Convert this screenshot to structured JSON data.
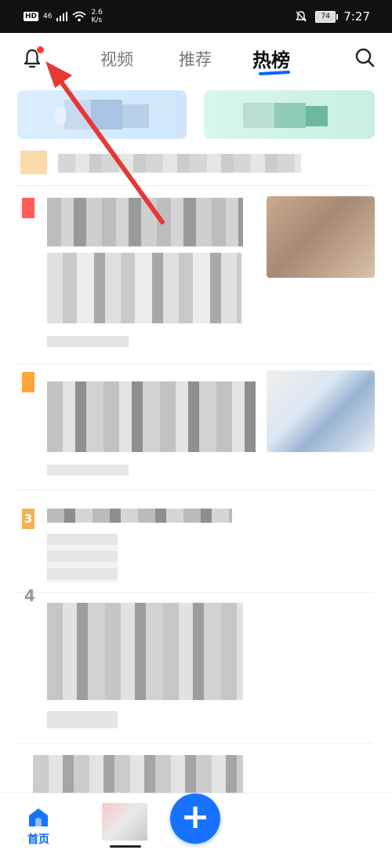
{
  "status_bar": {
    "hd": "HD",
    "signal": "46",
    "net_speed_value": "2.6",
    "net_speed_unit": "K/s",
    "battery": "74",
    "time": "7:27"
  },
  "top_nav": {
    "tabs": [
      {
        "label": "视频"
      },
      {
        "label": "推荐"
      },
      {
        "label": "热榜"
      }
    ]
  },
  "hot_list": {
    "ranks": [
      "",
      "",
      "3",
      "4"
    ]
  },
  "bottom_nav": {
    "home_label": "首页",
    "add_label": "+"
  },
  "colors": {
    "accent": "#0066ff",
    "rank1": "#ff5a57",
    "rank2": "#ffa43a",
    "rank3": "#f2b152",
    "annotation_arrow": "#e53935"
  }
}
